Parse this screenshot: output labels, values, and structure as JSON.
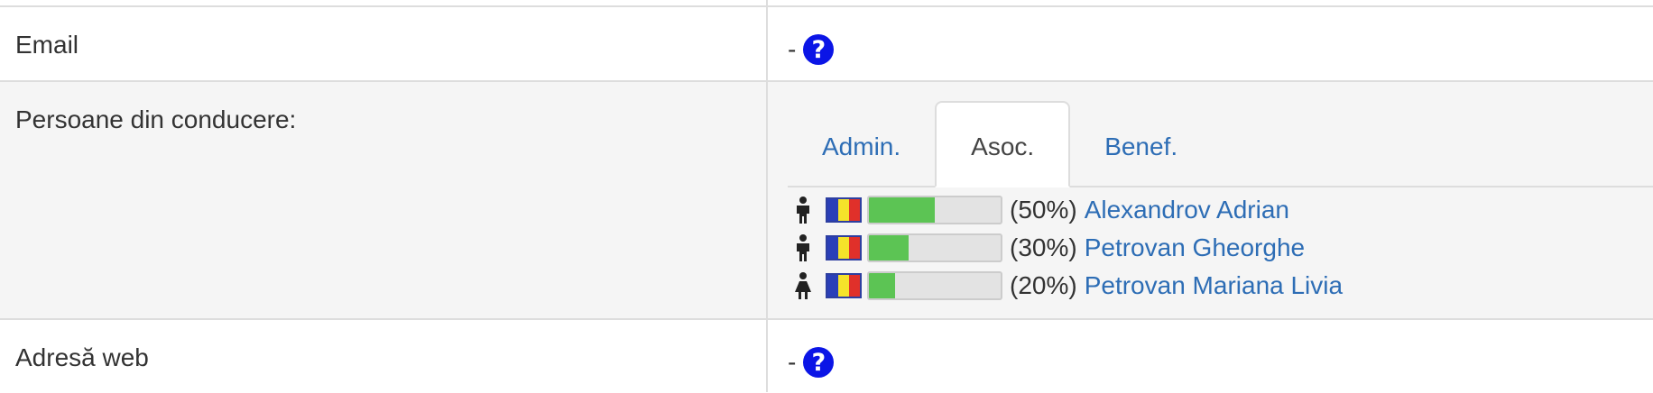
{
  "rows": {
    "email": {
      "label": "Email",
      "value": "-",
      "help_icon": "question-circle-icon"
    },
    "leaders": {
      "label": "Persoane din conducere:",
      "tabs": [
        {
          "label": "Admin.",
          "active": false
        },
        {
          "label": "Asoc.",
          "active": true
        },
        {
          "label": "Benef.",
          "active": false
        }
      ],
      "people": [
        {
          "gender": "male",
          "icon": "male-person-icon",
          "flag": "romania-flag-icon",
          "share": 0.5,
          "percent_text": "(50%)",
          "name": "Alexandrov Adrian"
        },
        {
          "gender": "male",
          "icon": "male-person-icon",
          "flag": "romania-flag-icon",
          "share": 0.3,
          "percent_text": "(30%)",
          "name": "Petrovan Gheorghe"
        },
        {
          "gender": "female",
          "icon": "female-person-icon",
          "flag": "romania-flag-icon",
          "share": 0.2,
          "percent_text": "(20%)",
          "name": "Petrovan Mariana Livia"
        }
      ]
    },
    "web": {
      "label": "Adresă web",
      "value": "-",
      "help_icon": "question-circle-icon"
    }
  },
  "colors": {
    "link": "#2d6db5",
    "help_icon_bg": "#0b15e6",
    "bar_fill": "#5cc454",
    "flag_blue": "#2a3fb8",
    "flag_yellow": "#f5e32a",
    "flag_red": "#e0302a"
  }
}
